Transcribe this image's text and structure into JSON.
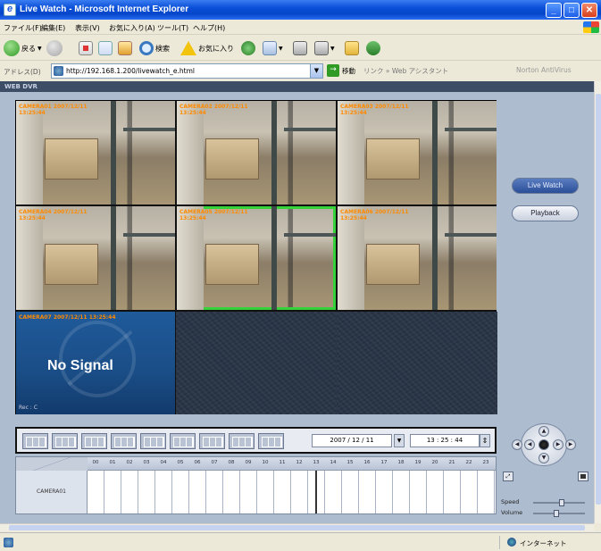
{
  "window": {
    "title": "Live Watch - Microsoft Internet Explorer"
  },
  "menu": [
    "ファイル(F)",
    "編集(E)",
    "表示(V)",
    "お気に入り(A)",
    "ツール(T)",
    "ヘルプ(H)"
  ],
  "toolbar": {
    "back_label": "戻る",
    "search_label": "検索",
    "favorites_label": "お気に入り"
  },
  "address": {
    "label": "アドレス(D)",
    "url": "http://192.168.1.200/livewatch_e.html",
    "go_label": "移動",
    "links": "リンク »  Web アシスタント",
    "norton": "Norton AntiVirus"
  },
  "page": {
    "header": "WEB DVR",
    "cameras": [
      {
        "osd1": "CAMERA01 2007/12/11",
        "osd2": "13:25:44"
      },
      {
        "osd1": "CAMERA02 2007/12/11",
        "osd2": "13:25:44"
      },
      {
        "osd1": "CAMERA03 2007/12/11",
        "osd2": "13:25:44"
      },
      {
        "osd1": "CAMERA04 2007/12/11",
        "osd2": "13:25:44"
      },
      {
        "osd1": "CAMERA05 2007/12/11",
        "osd2": "13:25:44"
      },
      {
        "osd1": "CAMERA06 2007/12/11",
        "osd2": "13:25:44"
      }
    ],
    "no_signal": {
      "osd": "CAMERA07 2007/12/11 13:25:44",
      "text": "No Signal",
      "rec": "Rec : C"
    },
    "side_buttons": {
      "live": "Live Watch",
      "playback": "Playback"
    },
    "date": "2007 / 12 / 11",
    "time": "13 : 25 : 44",
    "timeline": {
      "hours": [
        "00",
        "01",
        "02",
        "03",
        "04",
        "05",
        "06",
        "07",
        "08",
        "09",
        "10",
        "11",
        "12",
        "13",
        "14",
        "15",
        "16",
        "17",
        "18",
        "19",
        "20",
        "21",
        "22",
        "23"
      ],
      "camera_label": "CAMERA01"
    },
    "controls": {
      "speed_label": "Speed",
      "volume_label": "Volume",
      "speed_level": 0.55,
      "volume_level": 0.45
    }
  },
  "status": {
    "left": "",
    "zone": "インターネット"
  }
}
